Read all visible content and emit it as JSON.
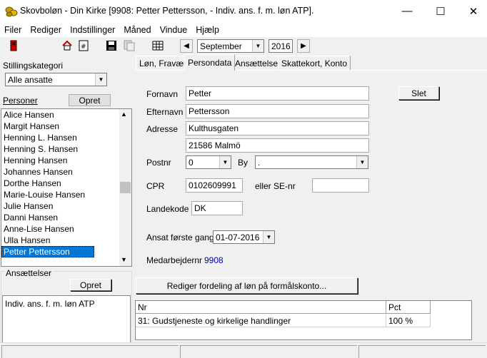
{
  "window": {
    "title": "Skovboløn - Din Kirke [9908: Petter Pettersson, - Indiv. ans. f. m. løn ATP].",
    "minimize": "—",
    "maximize": "☐",
    "close": "✕"
  },
  "menu": [
    "Filer",
    "Rediger",
    "Indstillinger",
    "Måned",
    "Vindue",
    "Hjælp"
  ],
  "toolbar": {
    "month": "September",
    "year": "2016",
    "prev": "◀",
    "next": "▶"
  },
  "left": {
    "category_label": "Stillingskategori",
    "category_value": "Alle ansatte",
    "persons_label": "Personer",
    "create_label": "Opret",
    "persons": [
      "Alice Hansen",
      "Margit Hansen",
      "Henning L. Hansen",
      "Henning S. Hansen",
      "Henning Hansen",
      "Johannes Hansen",
      "Dorthe Hansen",
      "Marie-Louise Hansen",
      "Julie Hansen",
      "Danni Hansen",
      "Anne-Lise Hansen",
      "Ulla Hansen",
      "Petter Pettersson"
    ],
    "selected_index": 12,
    "employments_label": "Ansættelser",
    "employments_create": "Opret",
    "employments": [
      "Indiv. ans. f. m. løn ATP"
    ]
  },
  "tabs": [
    "Løn, Fravær",
    "Persondata",
    "Ansættelse",
    "Skattekort, Konto"
  ],
  "active_tab": 1,
  "form": {
    "firstname_label": "Fornavn",
    "firstname": "Petter",
    "lastname_label": "Efternavn",
    "lastname": "Pettersson",
    "address_label": "Adresse",
    "address1": "Kulthusgaten",
    "address2": "21586 Malmö",
    "postal_label": "Postnr",
    "postal": "0",
    "city_label": "By",
    "city": ".",
    "cpr_label": "CPR",
    "cpr": "0102609991",
    "se_label": "eller SE-nr",
    "se": "",
    "country_label": "Landekode",
    "country": "DK",
    "hired_label": "Ansat første gang",
    "hired": "01-07-2016",
    "empno_label": "Medarbejdernr",
    "empno": "9908",
    "delete_label": "Slet",
    "edit_dist_label": "Rediger fordeling af løn på formålskonto..."
  },
  "grid": {
    "headers": [
      "Nr",
      "Pct"
    ],
    "rows": [
      [
        "31: Gudstjeneste og kirkelige handlinger",
        "100 %"
      ]
    ]
  },
  "colors": {
    "selection": "#0078d7",
    "empno": "#0000c0"
  }
}
